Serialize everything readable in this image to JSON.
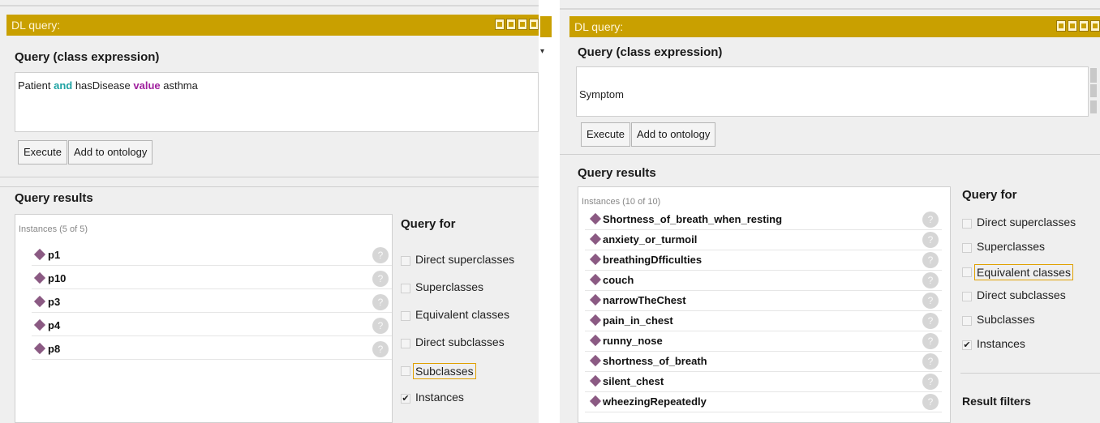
{
  "left": {
    "title": "DL query:",
    "query_heading": "Query (class expression)",
    "query_text": {
      "part1": "Patient ",
      "kw_and": "and",
      "part2": " hasDisease ",
      "kw_value": "value",
      "part3": " asthma"
    },
    "execute_label": "Execute",
    "add_label": "Add to ontology",
    "results_heading": "Query results",
    "instances_count": "Instances (5 of 5)",
    "instances": [
      "p1",
      "p10",
      "p3",
      "p4",
      "p8"
    ],
    "query_for_title": "Query for",
    "query_for": [
      {
        "label": "Direct superclasses",
        "checked": false
      },
      {
        "label": "Superclasses",
        "checked": false
      },
      {
        "label": "Equivalent classes",
        "checked": false
      },
      {
        "label": "Direct subclasses",
        "checked": false
      },
      {
        "label": "Subclasses",
        "checked": false
      },
      {
        "label": "Instances",
        "checked": true
      }
    ]
  },
  "right": {
    "title": "DL query:",
    "query_heading": "Query (class expression)",
    "query_text": "Symptom",
    "execute_label": "Execute",
    "add_label": "Add to ontology",
    "results_heading": "Query results",
    "instances_count": "Instances (10 of 10)",
    "instances": [
      "Shortness_of_breath_when_resting",
      "anxiety_or_turmoil",
      "breathingDfficulties",
      "couch",
      "narrowTheChest",
      "pain_in_chest",
      "runny_nose",
      "shortness_of_breath",
      "silent_chest",
      "wheezingRepeatedly"
    ],
    "query_for_title": "Query for",
    "query_for": [
      {
        "label": "Direct superclasses",
        "checked": false
      },
      {
        "label": "Superclasses",
        "checked": false
      },
      {
        "label": "Equivalent classes",
        "checked": false
      },
      {
        "label": "Direct subclasses",
        "checked": false
      },
      {
        "label": "Subclasses",
        "checked": false
      },
      {
        "label": "Instances",
        "checked": true
      }
    ],
    "result_filters_title": "Result filters"
  },
  "help_glyph": "?",
  "check_glyph": "✔",
  "colors": {
    "titlebar": "#c9a000",
    "diamond": "#8b5a83",
    "keyword_and": "#1fa3a3",
    "keyword_value": "#a0209e"
  }
}
